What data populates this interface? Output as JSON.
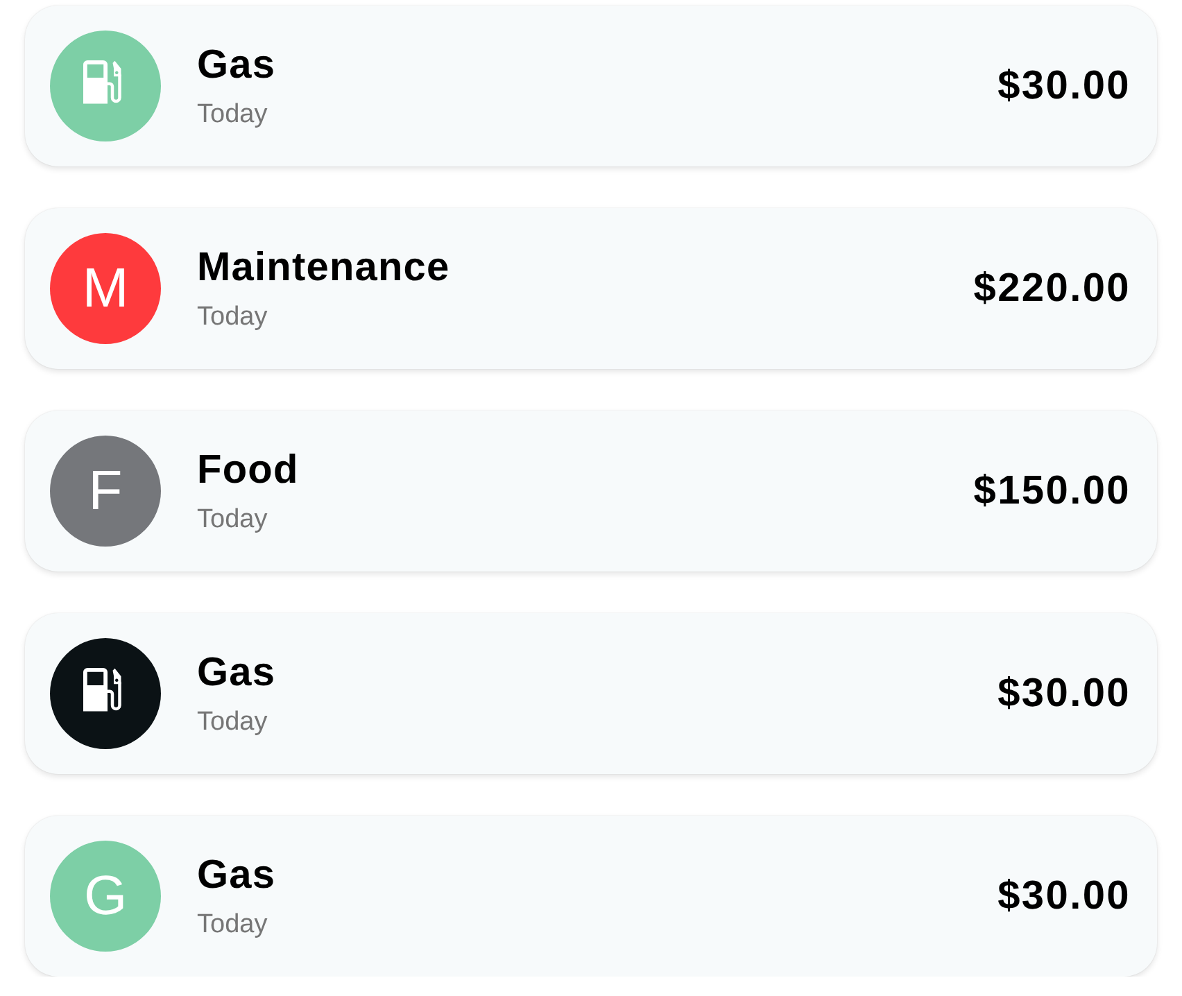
{
  "transactions": [
    {
      "title": "Gas",
      "date": "Today",
      "amount": "$30.00",
      "avatar": {
        "kind": "icon",
        "color": "#7dcfa6"
      }
    },
    {
      "title": "Maintenance",
      "date": "Today",
      "amount": "$220.00",
      "avatar": {
        "kind": "letter",
        "letter": "M",
        "color": "#fe3a3d"
      }
    },
    {
      "title": "Food",
      "date": "Today",
      "amount": "$150.00",
      "avatar": {
        "kind": "letter",
        "letter": "F",
        "color": "#75777b"
      }
    },
    {
      "title": "Gas",
      "date": "Today",
      "amount": "$30.00",
      "avatar": {
        "kind": "icon",
        "color": "#0b1215"
      }
    },
    {
      "title": "Gas",
      "date": "Today",
      "amount": "$30.00",
      "avatar": {
        "kind": "letter",
        "letter": "G",
        "color": "#7dcfa6"
      }
    }
  ]
}
